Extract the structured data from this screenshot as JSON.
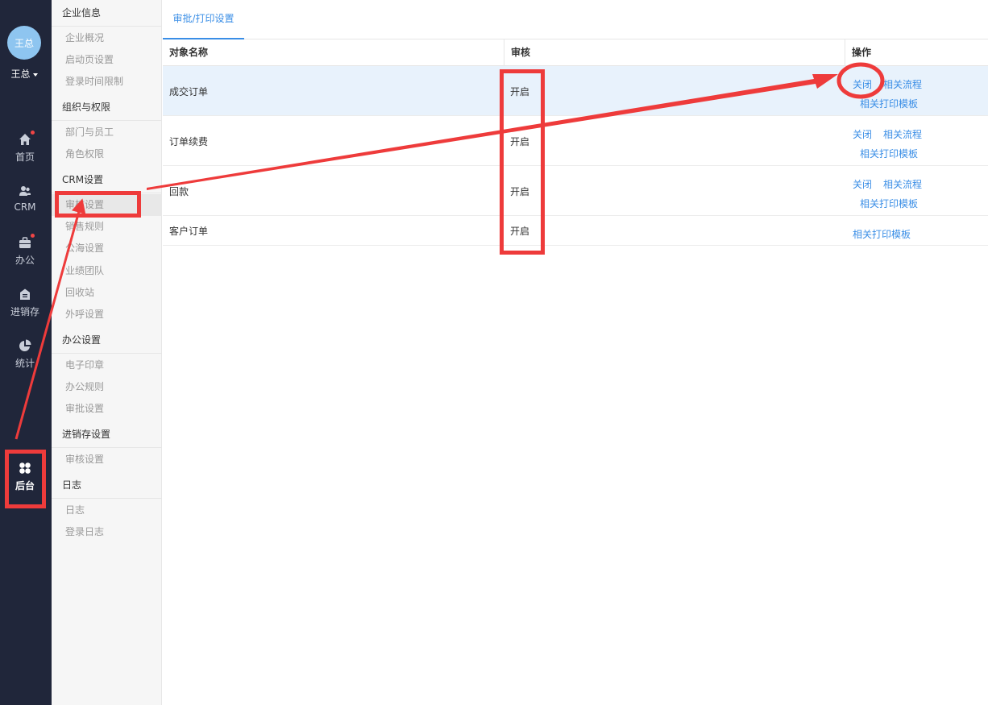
{
  "user": {
    "avatar_text": "王总",
    "name": "王总"
  },
  "nav": [
    {
      "label": "首页",
      "icon": "home-icon",
      "dot": true
    },
    {
      "label": "CRM",
      "icon": "users-icon",
      "dot": false
    },
    {
      "label": "办公",
      "icon": "briefcase-icon",
      "dot": true
    },
    {
      "label": "进销存",
      "icon": "warehouse-icon",
      "dot": false
    },
    {
      "label": "统计",
      "icon": "pie-chart-icon",
      "dot": false
    },
    {
      "label": "后台",
      "icon": "grid-icon",
      "dot": false
    }
  ],
  "sidebar": {
    "groups": [
      {
        "title": "企业信息",
        "items": [
          "企业概况",
          "启动页设置",
          "登录时间限制"
        ]
      },
      {
        "title": "组织与权限",
        "items": [
          "部门与员工",
          "角色权限"
        ]
      },
      {
        "title": "CRM设置",
        "items": [
          "审核设置",
          "销售规则",
          "公海设置",
          "业绩团队",
          "回收站",
          "外呼设置"
        ]
      },
      {
        "title": "办公设置",
        "items": [
          "电子印章",
          "办公规则",
          "审批设置"
        ]
      },
      {
        "title": "进销存设置",
        "items": [
          "审核设置"
        ]
      },
      {
        "title": "日志",
        "items": [
          "日志",
          "登录日志"
        ]
      }
    ]
  },
  "tab": {
    "label": "审批/打印设置"
  },
  "table": {
    "headers": [
      "对象名称",
      "审核",
      "操作"
    ],
    "rows": [
      {
        "name": "成交订单",
        "status": "开启",
        "close": "关闭",
        "flow": "相关流程",
        "print": "相关打印模板"
      },
      {
        "name": "订单续费",
        "status": "开启",
        "close": "关闭",
        "flow": "相关流程",
        "print": "相关打印模板"
      },
      {
        "name": "回款",
        "status": "开启",
        "close": "关闭",
        "flow": "相关流程",
        "print": "相关打印模板"
      },
      {
        "name": "客户订单",
        "status": "开启",
        "print": "相关打印模板"
      }
    ]
  },
  "colors": {
    "nav_bg": "#20263a",
    "accent": "#3a8ee6",
    "annotation": "#ee3b3b",
    "row_highlight": "#e8f2fc"
  }
}
